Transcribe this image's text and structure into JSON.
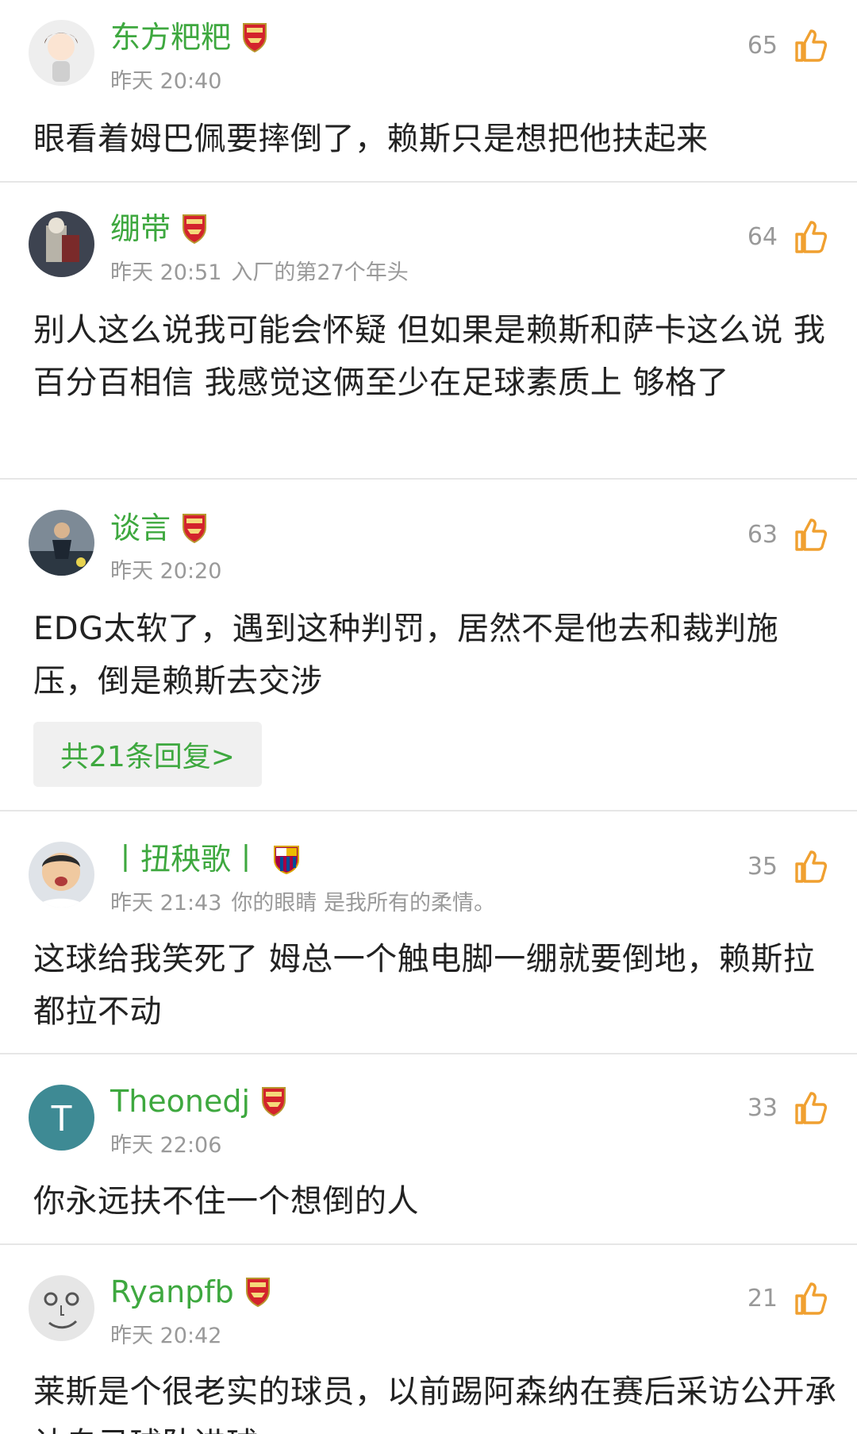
{
  "colors": {
    "username": "#3ea83f",
    "meta": "#999999",
    "like_icon": "#f0a030",
    "divider": "#e6e6e6"
  },
  "icons": {
    "like": "thumbs-up-icon",
    "arsenal_badge": "arsenal-badge-icon",
    "barcelona_badge": "barcelona-badge-icon"
  },
  "comments": [
    {
      "username": "东方粑粑",
      "badge": "arsenal-badge-icon",
      "time": "昨天 20:40",
      "extra": "",
      "likes": "65",
      "text": "眼看着姆巴佩要摔倒了，赖斯只是想把他扶起来"
    },
    {
      "username": "绷带",
      "badge": "arsenal-badge-icon",
      "time": "昨天 20:51",
      "extra": "入厂的第27个年头",
      "likes": "64",
      "text": "别人这么说我可能会怀疑 但如果是赖斯和萨卡这么说 我百分百相信 我感觉这俩至少在足球素质上 够格了"
    },
    {
      "username": "谈言",
      "badge": "arsenal-badge-icon",
      "time": "昨天 20:20",
      "extra": "",
      "likes": "63",
      "text": "EDG太软了，遇到这种判罚，居然不是他去和裁判施压，倒是赖斯去交涉",
      "replies": "共21条回复>"
    },
    {
      "username": "丨扭秧歌丨",
      "badge": "barcelona-badge-icon",
      "time": "昨天 21:43",
      "extra": "你的眼睛 是我所有的柔情。",
      "likes": "35",
      "text": "这球给我笑死了 姆总一个触电脚一绷就要倒地，赖斯拉都拉不动"
    },
    {
      "username": "Theonedj",
      "badge": "arsenal-badge-icon",
      "time": "昨天 22:06",
      "extra": "",
      "likes": "33",
      "text": "你永远扶不住一个想倒的人",
      "avatar_letter": "T"
    },
    {
      "username": "Ryanpfb",
      "badge": "arsenal-badge-icon",
      "time": "昨天 20:42",
      "extra": "",
      "likes": "21",
      "text": "莱斯是个很老实的球员，以前踢阿森纳在赛后采访公开承认自己球队进球……"
    }
  ]
}
